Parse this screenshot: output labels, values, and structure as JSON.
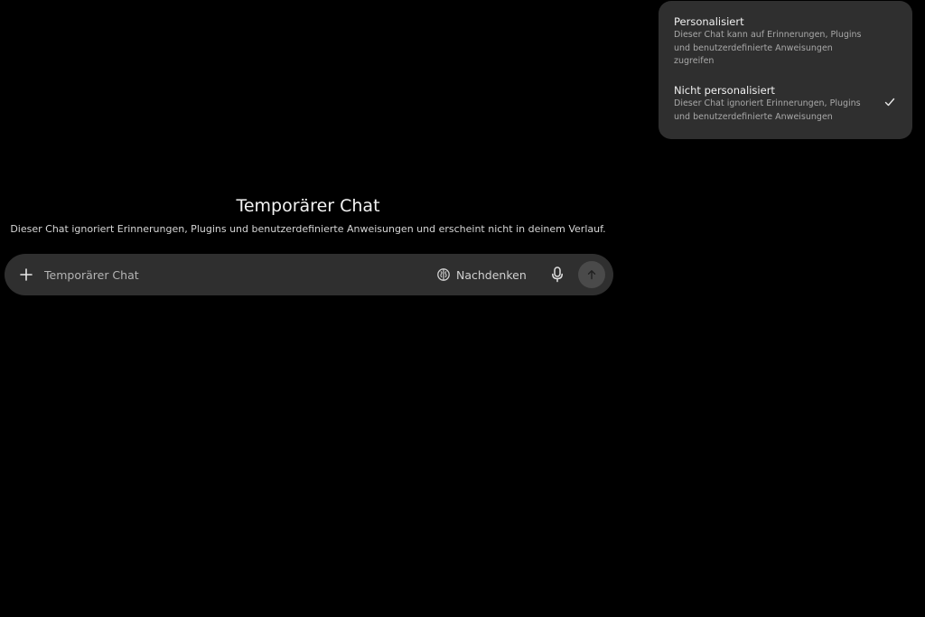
{
  "mode_menu": {
    "items": [
      {
        "title": "Personalisiert",
        "description": "Dieser Chat kann auf Erinnerungen, Plugins und benutzerdefinierte Anweisungen zugreifen",
        "selected": false
      },
      {
        "title": "Nicht personalisiert",
        "description": "Dieser Chat ignoriert Erinnerungen, Plugins und benutzerdefinierte Anweisungen",
        "selected": true
      }
    ],
    "check_icon": "checkmark-icon"
  },
  "main": {
    "title": "Temporärer Chat",
    "subtitle": "Dieser Chat ignoriert Erinnerungen, Plugins und benutzerdefinierte Anweisungen und erscheint nicht in deinem Verlauf."
  },
  "composer": {
    "placeholder": "Temporärer Chat",
    "value": "",
    "think_label": "Nachdenken",
    "icons": {
      "add": "plus-icon",
      "think": "brain-icon",
      "voice": "microphone-icon",
      "send": "arrow-up-icon"
    }
  },
  "colors": {
    "background": "#000000",
    "surface": "#2f2f2f",
    "send_button_disabled": "#4a4a4a",
    "text_primary": "#ececec",
    "text_secondary": "#a8a8a8"
  }
}
